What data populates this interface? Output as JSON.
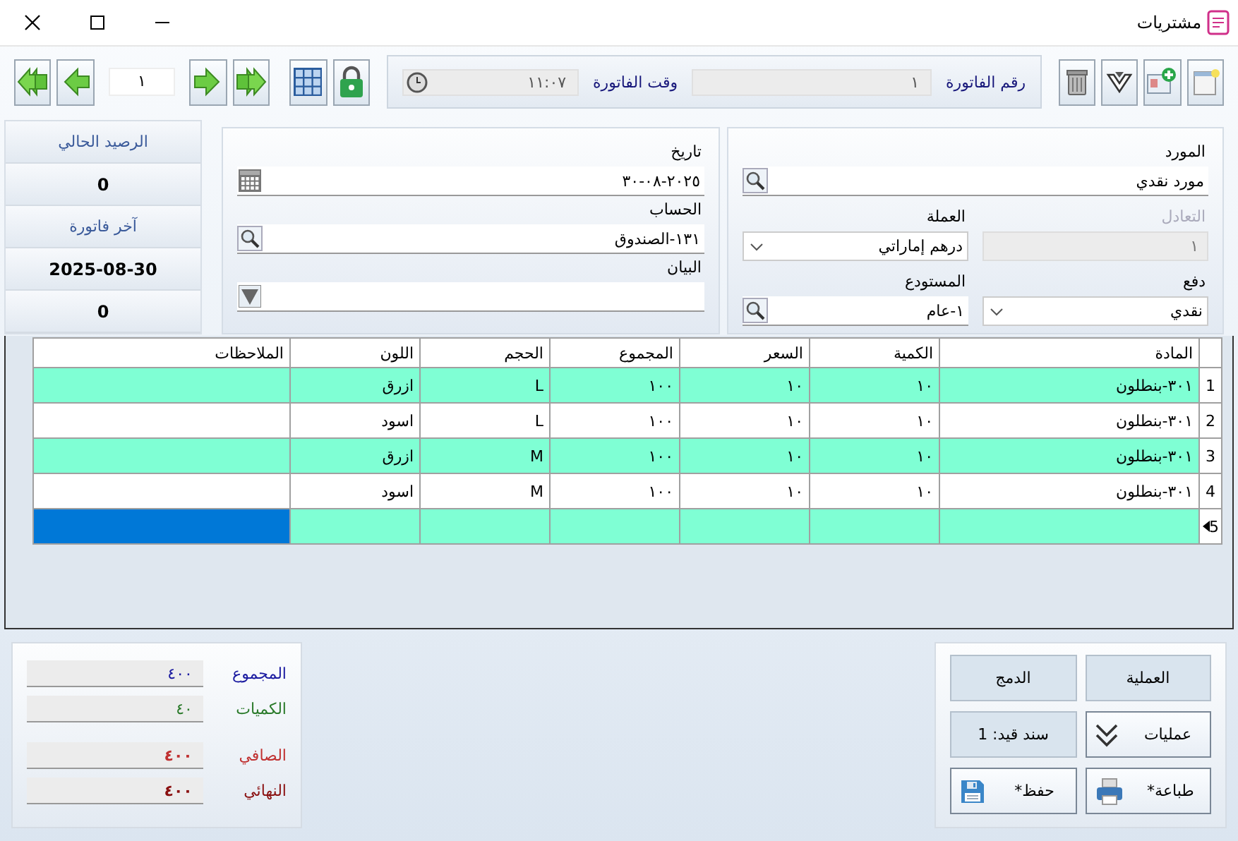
{
  "window": {
    "title": "مشتريات"
  },
  "invoice": {
    "number_label": "رقم الفاتورة",
    "number": "١",
    "time_label": "وقت الفاتورة",
    "time": "١١:٠٧"
  },
  "navigator": {
    "page": "١"
  },
  "supplier_panel": {
    "fields": [
      {
        "label": "المورد",
        "value": "مورد نقدي",
        "kind": "search",
        "disabled": false
      },
      {
        "label": "التعادل",
        "value": "١",
        "kind": "text",
        "disabled": true
      },
      {
        "label": "العملة",
        "value": "درهم إماراتي",
        "kind": "select",
        "disabled": false
      },
      {
        "label": "دفع",
        "value": "نقدي",
        "kind": "select",
        "disabled": false
      },
      {
        "label": "المستودع",
        "value": "١-عام",
        "kind": "search",
        "disabled": false
      }
    ]
  },
  "date_panel": {
    "fields": [
      {
        "label": "تاريخ",
        "value": "٢٠٢٥-٠٨-٣٠",
        "kind": "date"
      },
      {
        "label": "الحساب",
        "value": "١٣١-الصندوق",
        "kind": "search"
      },
      {
        "label": "البيان",
        "kind": "dropdown"
      }
    ]
  },
  "balance_sidebar": {
    "items": [
      {
        "text": "الرصيد الحالي",
        "kind": "label"
      },
      {
        "text": "0",
        "kind": "value"
      },
      {
        "text": "آخر فاتورة",
        "kind": "label"
      },
      {
        "text": "2025-08-30",
        "kind": "value"
      },
      {
        "text": "0",
        "kind": "value"
      }
    ]
  },
  "table": {
    "columns": [
      "المادة",
      "الكمية",
      "السعر",
      "المجموع",
      "الحجم",
      "اللون",
      "الملاحظات"
    ],
    "rows": [
      {
        "number": "1",
        "shaded": true,
        "cells": [
          "٣٠١-بنطلون",
          "١٠",
          "١٠",
          "١٠٠",
          "L",
          "ازرق",
          ""
        ]
      },
      {
        "number": "2",
        "shaded": false,
        "cells": [
          "٣٠١-بنطلون",
          "١٠",
          "١٠",
          "١٠٠",
          "L",
          "اسود",
          ""
        ]
      },
      {
        "number": "3",
        "shaded": true,
        "cells": [
          "٣٠١-بنطلون",
          "١٠",
          "١٠",
          "١٠٠",
          "M",
          "ازرق",
          ""
        ]
      },
      {
        "number": "4",
        "shaded": false,
        "cells": [
          "٣٠١-بنطلون",
          "١٠",
          "١٠",
          "١٠٠",
          "M",
          "اسود",
          ""
        ]
      }
    ],
    "new_row": {
      "number": "5",
      "cells": [
        {
          "selected": false
        },
        {
          "selected": false
        },
        {
          "selected": false
        },
        {
          "selected": false
        },
        {
          "selected": false
        },
        {
          "selected": false
        },
        {
          "selected": true
        }
      ]
    }
  },
  "totals": [
    {
      "label": "المجموع",
      "value": "٤٠٠",
      "color": "#1a1aa0"
    },
    {
      "label": "الكميات",
      "value": "٤٠",
      "color": "#2a7a2a"
    },
    {
      "label": "الصافي",
      "value": "٤٠٠",
      "color": "#c03030"
    },
    {
      "label": "النهائي",
      "value": "٤٠٠",
      "color": "#8a1010"
    }
  ],
  "actions": [
    {
      "label": "العملية",
      "kind": "plain"
    },
    {
      "label": "الدمج",
      "kind": "plain"
    },
    {
      "label": "عمليات",
      "kind": "chevrons"
    },
    {
      "label": "سند قيد: 1",
      "kind": "plain"
    },
    {
      "label": "طباعة*",
      "kind": "printer"
    },
    {
      "label": "حفظ*",
      "kind": "save"
    }
  ]
}
